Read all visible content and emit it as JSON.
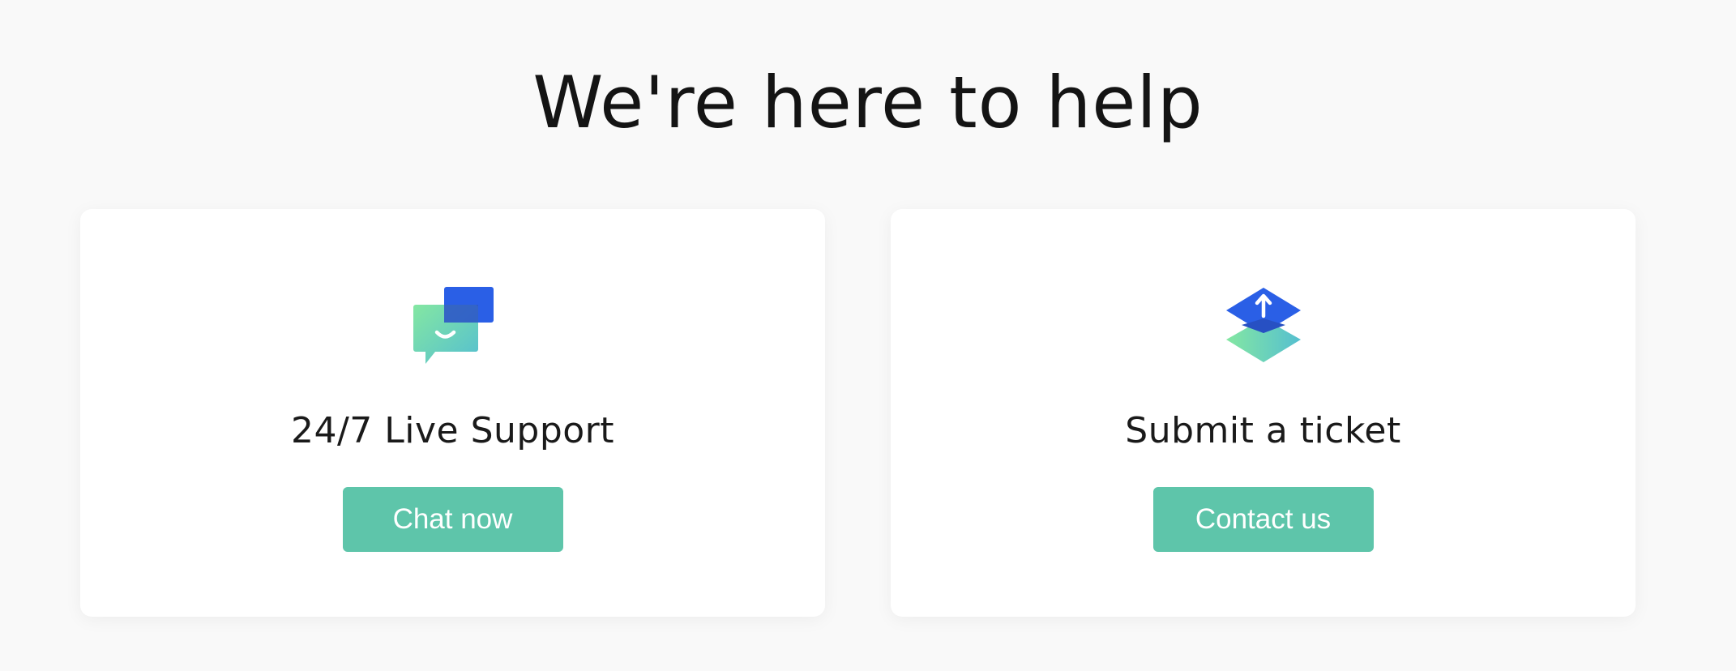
{
  "header": {
    "title": "We're here to help"
  },
  "cards": [
    {
      "icon": "chat-bubbles-icon",
      "title": "24/7 Live Support",
      "button_label": "Chat now"
    },
    {
      "icon": "layered-upload-icon",
      "title": "Submit a ticket",
      "button_label": "Contact us"
    }
  ],
  "colors": {
    "page_background": "#f9f9f9",
    "card_background": "#ffffff",
    "button": "#5ec5aa",
    "icon_blue": "#2a5fe6",
    "icon_green": "#7ee0a4",
    "icon_teal": "#5cc2c9"
  }
}
